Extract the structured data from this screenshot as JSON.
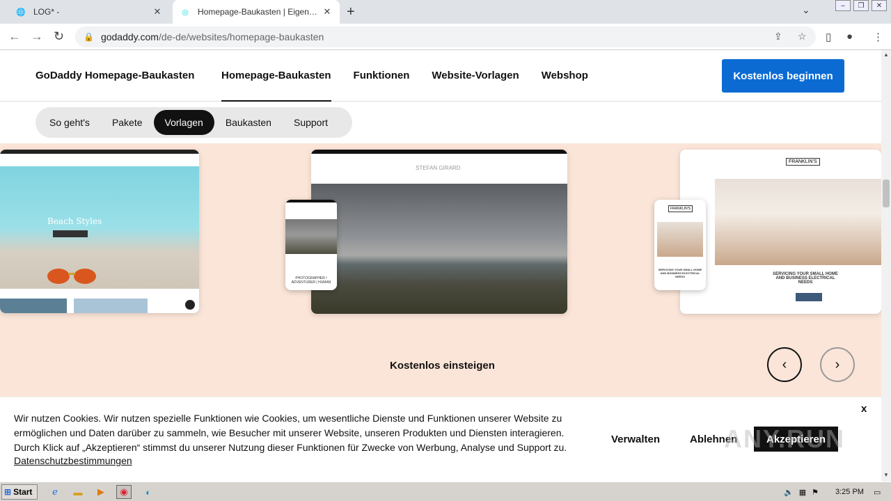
{
  "browser": {
    "tabs": [
      {
        "title": "LOG* -",
        "active": false
      },
      {
        "title": "Homepage-Baukasten | Eigene Website",
        "active": true
      }
    ],
    "url_host": "godaddy.com",
    "url_path": "/de-de/websites/homepage-baukasten"
  },
  "header": {
    "brand": "GoDaddy Homepage-Baukasten",
    "nav": [
      "Homepage-Baukasten",
      "Funktionen",
      "Website-Vorlagen",
      "Webshop"
    ],
    "cta": "Kostenlos beginnen"
  },
  "subnav": {
    "items": [
      "So geht's",
      "Pakete",
      "Vorlagen",
      "Baukasten",
      "Support"
    ],
    "selected": "Vorlagen"
  },
  "templates": {
    "card1": {
      "headline": "Beach Styles"
    },
    "card2": {
      "brand": "STEFAN GIRARD",
      "mobile_caption": "PHOTOGRAPHER / ADVENTURER | HUMAN"
    },
    "card3": {
      "brand": "FRANKLIN'S",
      "headline": "SERVICING YOUR SMALL HOME AND BUSINESS ELECTRICAL NEEDS"
    }
  },
  "hero": {
    "start_free": "Kostenlos einsteigen",
    "prev_label": "‹",
    "next_label": "›"
  },
  "cookie": {
    "text": "Wir nutzen Cookies. Wir nutzen spezielle Funktionen wie Cookies, um wesentliche Dienste und Funktionen unserer Website zu ermöglichen und Daten darüber zu sammeln, wie Besucher mit unserer Website, unseren Produkten und Diensten interagieren. Durch Klick auf „Akzeptieren“ stimmst du unserer Nutzung dieser Funktionen für Zwecke von Werbung, Analyse und Support zu.",
    "link": "Datenschutzbestimmungen",
    "manage": "Verwalten",
    "reject": "Ablehnen",
    "accept": "Akzeptieren",
    "close": "x"
  },
  "watermark": "ANY.RUN",
  "taskbar": {
    "start": "Start",
    "clock": "3:25 PM"
  },
  "colors": {
    "cta": "#0b6bd3",
    "hero_bg": "#fbe5d8"
  }
}
